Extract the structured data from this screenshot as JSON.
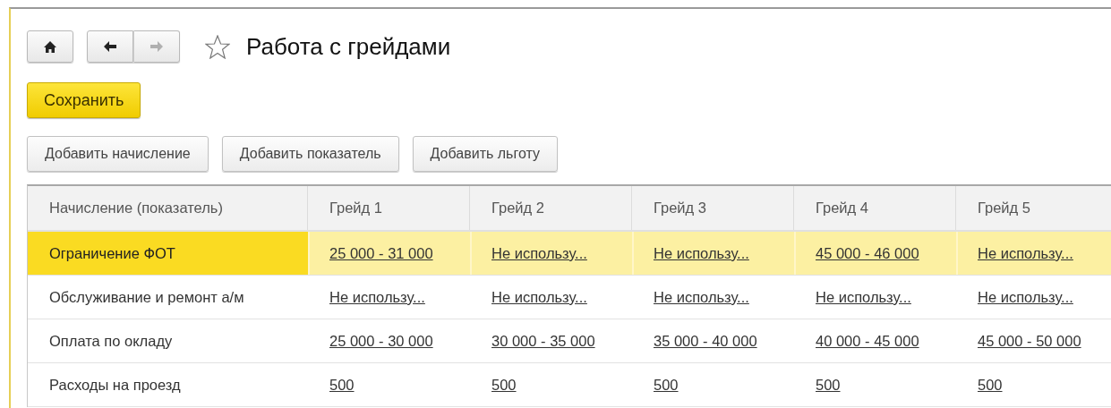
{
  "nav": {
    "home": {
      "disabled": false
    },
    "back": {
      "disabled": false
    },
    "forward": {
      "disabled": true
    },
    "favorite": {
      "on": false
    }
  },
  "window": {
    "title": "Работа с грейдами"
  },
  "save_button": "Сохранить",
  "buttons": [
    "Добавить начисление",
    "Добавить показатель",
    "Добавить льготу"
  ],
  "table": {
    "columns": [
      "Начисление (показатель)",
      "Грейд 1",
      "Грейд 2",
      "Грейд 3",
      "Грейд 4",
      "Грейд 5"
    ],
    "rows": [
      {
        "selected": true,
        "cells": [
          "Ограничение ФОТ",
          "25 000 - 31 000",
          "Не использу...",
          "Не использу...",
          "45 000 - 46 000",
          "Не использу..."
        ]
      },
      {
        "selected": false,
        "cells": [
          "Обслуживание и ремонт а/м",
          "Не использу...",
          "Не использу...",
          "Не использу...",
          "Не использу...",
          "Не использу..."
        ]
      },
      {
        "selected": false,
        "cells": [
          "Оплата по окладу",
          "25 000 - 30 000",
          "30 000 - 35 000",
          "35 000 - 40 000",
          "40 000 - 45 000",
          "45 000 - 50 000"
        ]
      },
      {
        "selected": false,
        "cells": [
          "Расходы на проезд",
          "500",
          "500",
          "500",
          "500",
          "500"
        ]
      }
    ]
  }
}
